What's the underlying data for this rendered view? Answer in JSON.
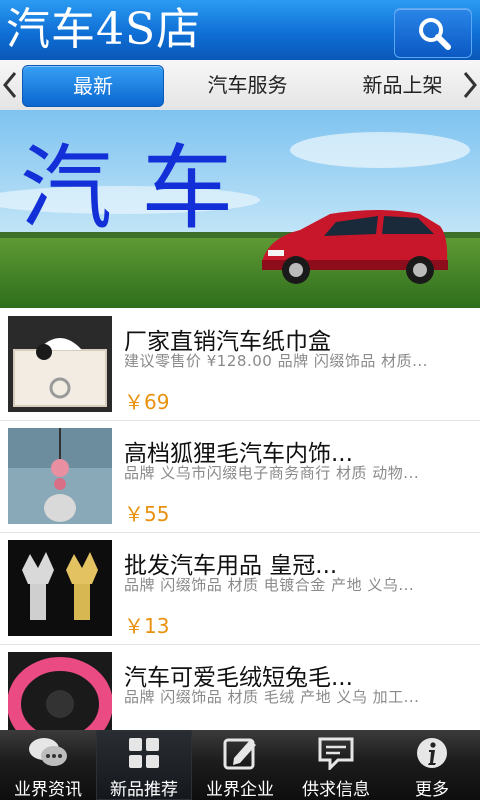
{
  "header": {
    "title": "汽车4S店",
    "search_icon": "search-icon"
  },
  "tabs": {
    "items": [
      "最新",
      "汽车服务",
      "新品上架"
    ],
    "active_index": 0
  },
  "banner": {
    "text": "汽 车"
  },
  "products": [
    {
      "name": "厂家直销汽车纸巾盒",
      "desc": "建议零售价 ¥128.00 品牌 闪缀饰品 材质...",
      "price": "￥69"
    },
    {
      "name": "高档狐狸毛汽车内饰...",
      "desc": "品牌 义乌市闪缀电子商务商行 材质 动物...",
      "price": "￥55"
    },
    {
      "name": "批发汽车用品 皇冠...",
      "desc": "品牌 闪缀饰品 材质 电镀合金 产地 义乌...",
      "price": "￥13"
    },
    {
      "name": "汽车可爱毛绒短兔毛...",
      "desc": "品牌 闪缀饰品 材质 毛绒 产地 义乌 加工...",
      "price": ""
    }
  ],
  "bottom_nav": [
    {
      "label": "业界资讯",
      "icon": "chat-bubbles-icon"
    },
    {
      "label": "新品推荐",
      "icon": "grid-icon"
    },
    {
      "label": "业界企业",
      "icon": "edit-icon"
    },
    {
      "label": "供求信息",
      "icon": "message-icon"
    },
    {
      "label": "更多",
      "icon": "info-icon"
    }
  ],
  "colors": {
    "header_blue": "#0f6fd6",
    "price_orange": "#e8920f",
    "bottom_bar": "#1c1c1c"
  }
}
